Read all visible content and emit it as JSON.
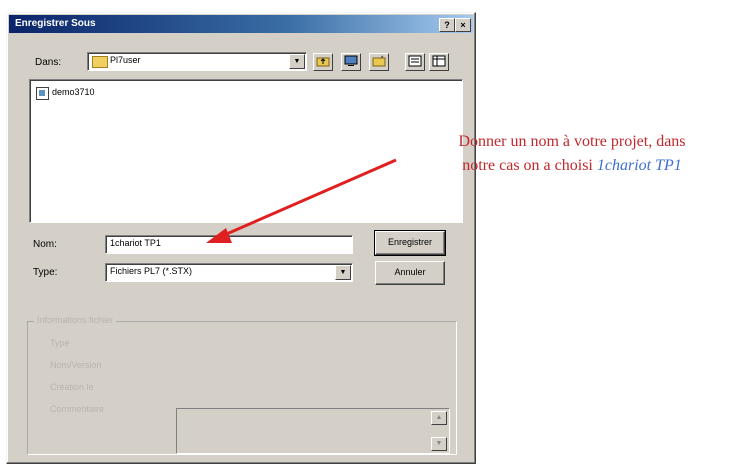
{
  "window": {
    "title": "Enregistrer Sous",
    "help_btn": "?",
    "close_btn": "×"
  },
  "lookin": {
    "label": "Dans:",
    "value": "Pl7user"
  },
  "toolbar": {
    "icons": [
      "up-folder-icon",
      "desktop-icon",
      "new-folder-icon",
      "list-view-icon",
      "details-view-icon"
    ]
  },
  "files": [
    {
      "name": "demo3710",
      "icon": "document-icon"
    }
  ],
  "filename": {
    "label": "Nom:",
    "value": "1chariot TP1"
  },
  "filetype": {
    "label": "Type:",
    "value": "Fichiers PL7 (*.STX)"
  },
  "buttons": {
    "save": "Enregistrer",
    "cancel": "Annuler"
  },
  "info_group": {
    "legend": "Informations fichier",
    "rows": [
      "Type",
      "Nom/Version",
      "Création le",
      "Commentaire"
    ]
  },
  "annotation": {
    "line1": "Donner un nom à votre projet, dans",
    "line2_prefix": "notre cas on a choisi ",
    "line2_emphasis": "1chariot TP1",
    "color": "#c0282c",
    "emphasis_color": "#3b6fd0"
  }
}
